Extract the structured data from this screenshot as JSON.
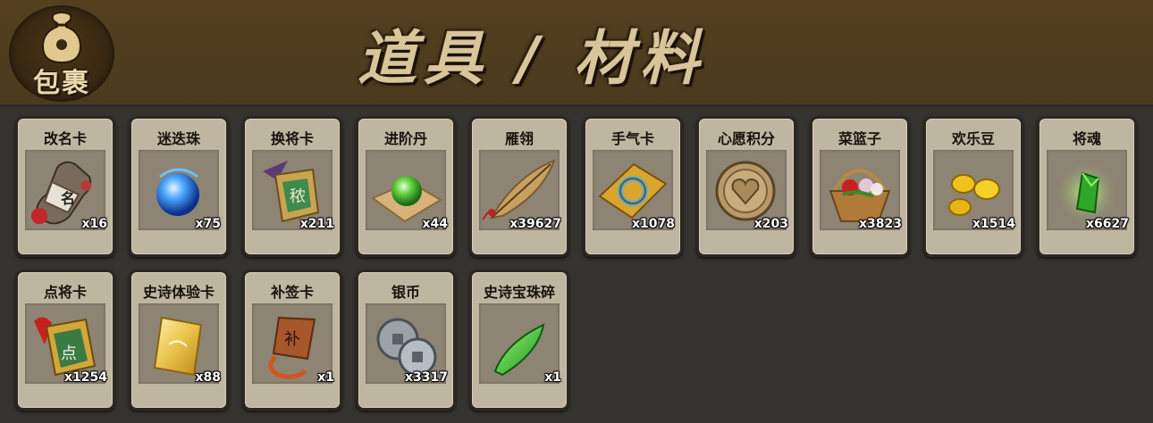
{
  "header": {
    "logo_text": "包裹",
    "title": "道具 / 材料"
  },
  "items": [
    {
      "name": "改名卡",
      "count": "x16",
      "icon": "name-card-icon"
    },
    {
      "name": "迷迭珠",
      "count": "x75",
      "icon": "blue-orb-icon"
    },
    {
      "name": "换将卡",
      "count": "x211",
      "icon": "swap-general-card-icon"
    },
    {
      "name": "进阶丹",
      "count": "x44",
      "icon": "green-pill-icon"
    },
    {
      "name": "雁翎",
      "count": "x39627",
      "icon": "feather-icon"
    },
    {
      "name": "手气卡",
      "count": "x1078",
      "icon": "luck-card-icon"
    },
    {
      "name": "心愿积分",
      "count": "x203",
      "icon": "heart-coin-icon"
    },
    {
      "name": "菜篮子",
      "count": "x3823",
      "icon": "flower-basket-icon"
    },
    {
      "name": "欢乐豆",
      "count": "x1514",
      "icon": "gold-beans-icon"
    },
    {
      "name": "将魂",
      "count": "x6627",
      "icon": "green-crystal-icon"
    },
    {
      "name": "点将卡",
      "count": "x1254",
      "icon": "pick-general-card-icon"
    },
    {
      "name": "史诗体验卡",
      "count": "x88",
      "icon": "gold-card-icon"
    },
    {
      "name": "补签卡",
      "count": "x1",
      "icon": "checkin-card-icon"
    },
    {
      "name": "银币",
      "count": "x3317",
      "icon": "silver-coins-icon"
    },
    {
      "name": "史诗宝珠碎",
      "count": "x1",
      "icon": "jade-shard-icon"
    }
  ]
}
